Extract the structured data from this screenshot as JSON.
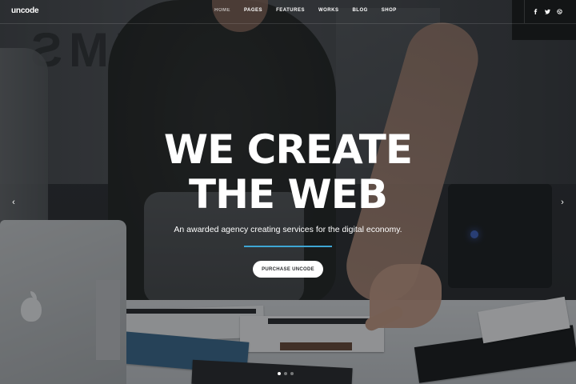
{
  "brand": {
    "logo": "uncode"
  },
  "nav": {
    "items": [
      {
        "label": "HOME",
        "active": true
      },
      {
        "label": "PAGES",
        "active": false
      },
      {
        "label": "FEATURES",
        "active": false
      },
      {
        "label": "WORKS",
        "active": false
      },
      {
        "label": "BLOG",
        "active": false
      },
      {
        "label": "SHOP",
        "active": false
      }
    ],
    "social": [
      {
        "icon": "facebook-icon",
        "glyph": "f"
      },
      {
        "icon": "twitter-icon",
        "glyph": "t"
      },
      {
        "icon": "dribbble-icon",
        "glyph": "d"
      }
    ]
  },
  "hero": {
    "headline_line1": "WE CREATE",
    "headline_line2": "THE WEB",
    "subtitle": "An awarded agency creating services for the digital economy.",
    "cta_label": "PURCHASE UNCODE",
    "prev_arrow": "‹",
    "next_arrow": "›",
    "slides_total": 3,
    "slide_active": 1
  },
  "colors": {
    "accent": "#3ea6d4",
    "text": "#ffffff",
    "button_bg": "#ffffff",
    "button_text": "#2c2e30"
  }
}
